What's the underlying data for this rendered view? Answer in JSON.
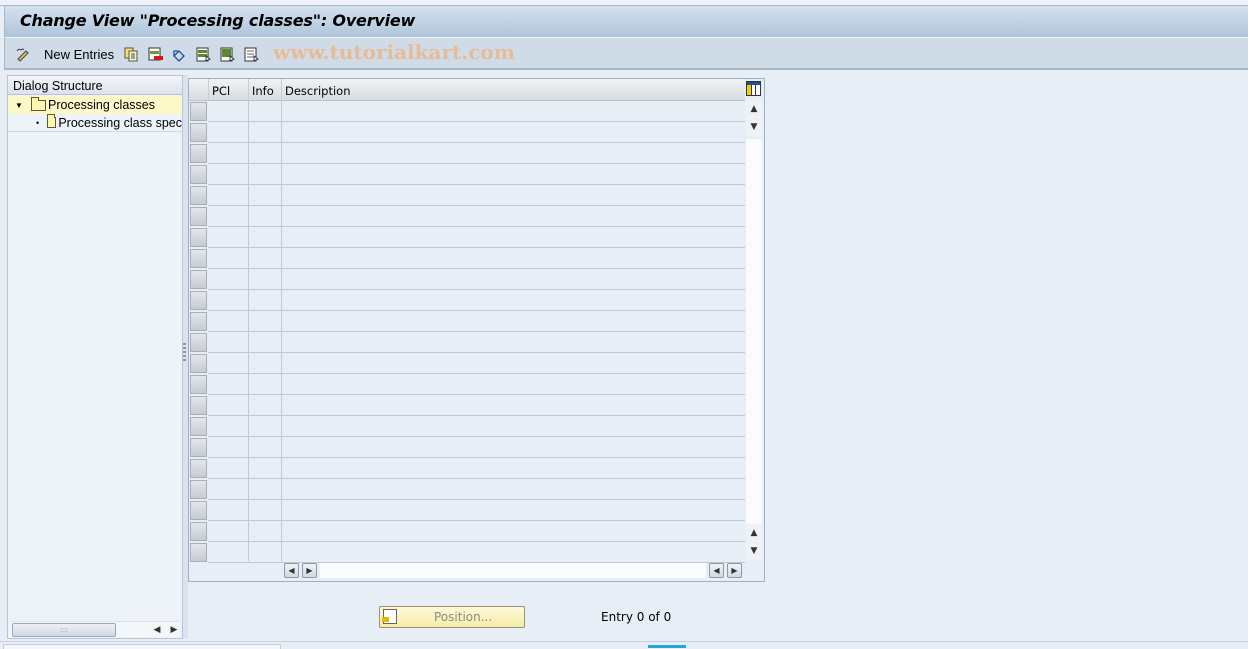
{
  "window": {
    "title": "Change View \"Processing classes\": Overview"
  },
  "toolbar": {
    "items": [
      {
        "icon": "change-display-icon"
      },
      {
        "label": "New Entries"
      },
      {
        "icon": "copy-as-icon"
      },
      {
        "icon": "delete-icon"
      },
      {
        "icon": "undo-change-icon"
      },
      {
        "icon": "select-all-icon"
      },
      {
        "icon": "select-block-icon"
      },
      {
        "icon": "deselect-all-icon"
      }
    ],
    "new_entries_label": "New Entries",
    "watermark": "www.tutorialkart.com"
  },
  "dialog_structure": {
    "header": "Dialog Structure",
    "nodes": [
      {
        "label": "Processing classes",
        "expanded": true,
        "selected": true,
        "level": 0
      },
      {
        "label": "Processing class spec",
        "expanded": false,
        "selected": false,
        "level": 1
      }
    ],
    "scroll_thumb_glyph": ":::"
  },
  "table": {
    "columns": [
      {
        "key": "pcl",
        "label": "PCl"
      },
      {
        "key": "info",
        "label": "Info"
      },
      {
        "key": "description",
        "label": "Description"
      }
    ],
    "rows": [],
    "visible_empty_rows": 22
  },
  "scroll_glyphs": {
    "up": "▲",
    "down": "▼",
    "left": "◀",
    "right": "▶"
  },
  "footer": {
    "position_button_label": "Position...",
    "entry_text": "Entry 0 of 0"
  }
}
